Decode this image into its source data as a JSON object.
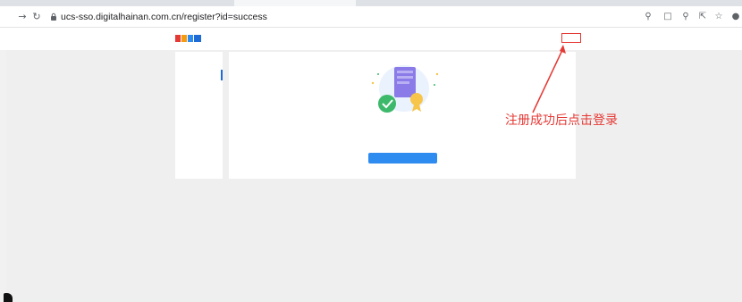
{
  "browser": {
    "url": "ucs-sso.digitalhainan.com.cn/register?id=success",
    "icons": [
      "back-icon",
      "reload-icon",
      "lock-icon",
      "key-icon",
      "translate-icon",
      "zoom-icon",
      "share-icon",
      "star-icon",
      "profile-icon"
    ]
  },
  "header": {
    "logo_alt": "",
    "logo_line1": "",
    "logo_line2": "",
    "has_account": "",
    "login_link": ""
  },
  "sidebar": {
    "items": [
      {
        "label": ""
      },
      {
        "label": ""
      }
    ]
  },
  "main": {
    "success_text": "",
    "primary_button": "",
    "secondary_link": ""
  },
  "annotation": {
    "text": "注册成功后点击登录"
  },
  "colors": {
    "accent": "#2e8bf0",
    "link": "#1e6bd6",
    "annotation": "#e53935"
  }
}
